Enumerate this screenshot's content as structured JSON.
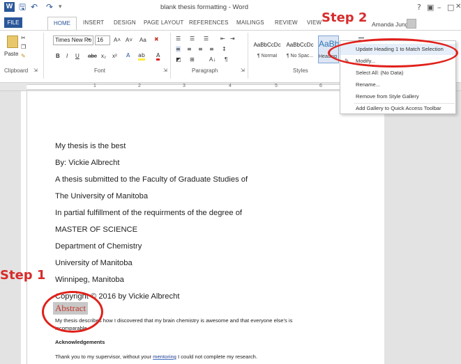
{
  "titlebar": {
    "app_icon": "W",
    "title": "blank thesis formatting - Word",
    "help": "?",
    "minimize": "–",
    "maximize": "□",
    "close": "✕"
  },
  "tabs": {
    "file": "FILE",
    "home": "HOME",
    "insert": "INSERT",
    "design": "DESIGN",
    "page_layout": "PAGE LAYOUT",
    "references": "REFERENCES",
    "mailings": "MAILINGS",
    "review": "REVIEW",
    "view": "VIEW",
    "user": "Amanda Jung"
  },
  "ribbon": {
    "clipboard": {
      "label": "Clipboard",
      "paste": "Paste"
    },
    "font": {
      "label": "Font",
      "name": "Times New Ro",
      "size": "16",
      "bold": "B",
      "italic": "I",
      "underline": "U",
      "strike": "abc",
      "subscript": "x₂",
      "superscript": "x²",
      "change_case": "Aa",
      "grow": "A˄",
      "shrink": "A˅"
    },
    "paragraph": {
      "label": "Paragraph",
      "pilcrow": "¶",
      "sort": "A↓"
    },
    "styles": {
      "label": "Styles",
      "items": [
        {
          "sample": "AaBbCcDc",
          "name": "¶ Normal"
        },
        {
          "sample": "AaBbCcDc",
          "name": "¶ No Spac..."
        },
        {
          "sample": "AaBb",
          "name": "Heading 1"
        }
      ]
    }
  },
  "ruler": {
    "marks": [
      "1",
      "2",
      "3",
      "4",
      "5",
      "6"
    ]
  },
  "document": {
    "lines": [
      "My thesis is the best",
      "By: Vickie Albrecht",
      "A thesis submitted to the Faculty of Graduate Studies of",
      "The University of Manitoba",
      "In partial fulfillment of the requirments of the degree of",
      "MASTER OF SCIENCE",
      "Department of Chemistry",
      "University of Manitoba",
      "Winnipeg, Manitoba",
      "Copyright © 2016 by Vickie Albrecht"
    ],
    "abstract_heading": "Abstract",
    "abstract_line1": "My thesis describes how I discovered that my brain chemistry is awesome and that everyone else's is",
    "abstract_line2": "incomparable.",
    "ack_heading": "Acknowledgements",
    "ack_text_before": "Thank you to my supervisor, without your ",
    "ack_link": "mentoring",
    "ack_text_after": " I could not complete my research."
  },
  "dropdown": {
    "items": [
      "Update Heading 1 to Match Selection",
      "Modify...",
      "Select All: (No Data)",
      "Rename...",
      "Remove from Style Gallery",
      "Add Gallery to Quick Access Toolbar"
    ]
  },
  "annotations": {
    "step1": "Step 1",
    "step2": "Step 2"
  },
  "colors": {
    "accent": "#2b579a",
    "annotation_red": "#e0201a",
    "heading_red": "#c0392b"
  }
}
